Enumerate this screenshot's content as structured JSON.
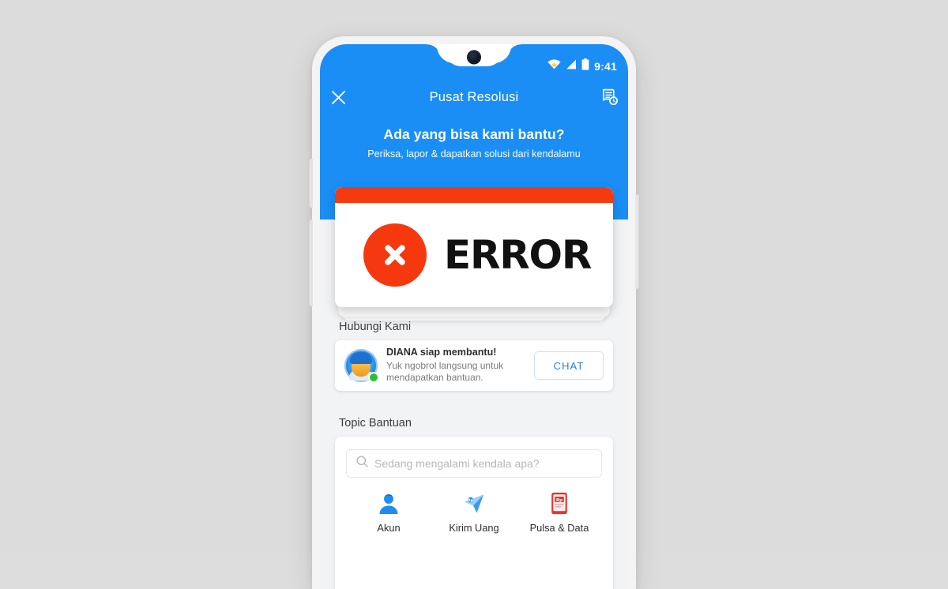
{
  "app": {
    "status_bar": {
      "time": "9:41",
      "icons": [
        "wifi-icon",
        "signal-icon",
        "battery-icon"
      ]
    },
    "app_bar": {
      "close_icon": "close-icon",
      "title": "Pusat Resolusi",
      "history_icon": "report-history-icon"
    },
    "hero": {
      "heading": "Ada yang bisa kami bantu?",
      "subheading": "Periksa, lapor & dapatkan solusi dari kendalamu"
    },
    "banner": {
      "icon": "error-circle-x-icon",
      "word": "ERROR",
      "accent_color": "#f6380e",
      "top_bar_color": "#f63a10"
    },
    "contact": {
      "section_title": "Hubungi Kami",
      "avatar": "diana-avatar",
      "online_indicator": "online-dot",
      "name_line": "DIANA siap membantu!",
      "desc_line": "Yuk ngobrol langsung untuk mendapatkan bantuan.",
      "button_label": "CHAT"
    },
    "topics": {
      "section_title": "Topic Bantuan",
      "search": {
        "icon": "search-icon",
        "placeholder": "Sedang mengalami kendala apa?",
        "value": ""
      },
      "items": [
        {
          "label": "Akun",
          "icon": "user-account-icon",
          "color": "#2196f3"
        },
        {
          "label": "Kirim Uang",
          "icon": "send-money-icon",
          "color": "#4da6f2"
        },
        {
          "label": "Pulsa & Data",
          "icon": "phone-credit-icon",
          "color": "#e8342c"
        }
      ]
    },
    "theme": {
      "brand_blue": "#1a8ef5",
      "page_background": "#f2f3f5",
      "desktop_background": "#dcdcdc"
    }
  }
}
